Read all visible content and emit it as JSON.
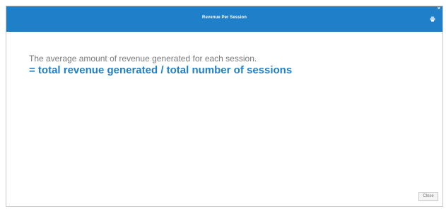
{
  "dialog": {
    "title": "Revenue Per Session",
    "close_symbol": "×",
    "header_icon": "print-icon",
    "description": "The average amount of revenue generated for each session.",
    "formula": "= total revenue generated / total number of sessions",
    "close_button_label": "Close"
  },
  "colors": {
    "title_bar": "#1f7fc9",
    "formula_text": "#1f7fc9",
    "description_text": "#7a7a7a"
  }
}
